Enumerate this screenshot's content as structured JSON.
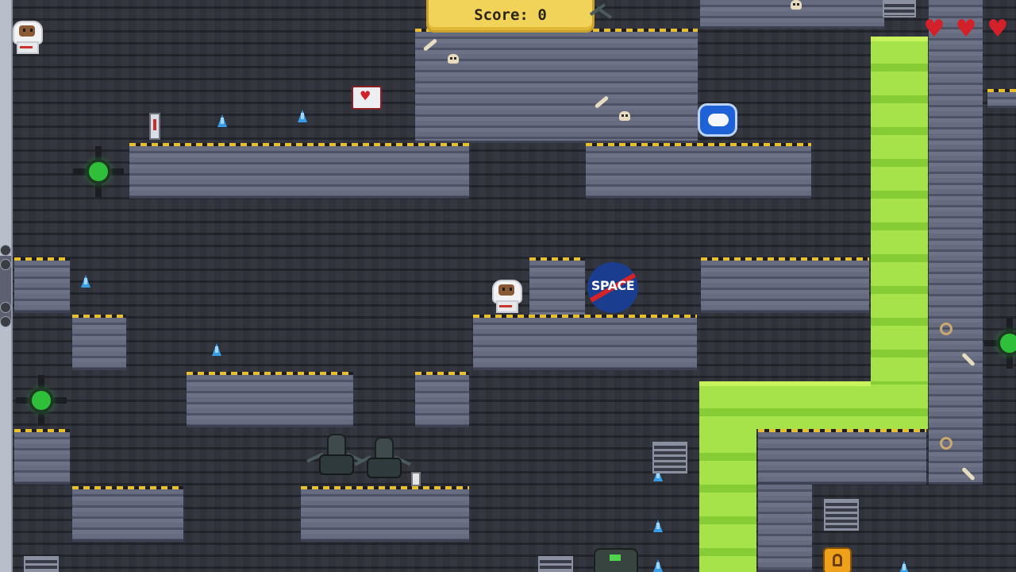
{
  "hud": {
    "score_label": "Score:",
    "score_value": "0",
    "lives": 3,
    "heart_glyph": "♥"
  },
  "space_logo": {
    "text": "SPACE"
  },
  "colors": {
    "acid": "#8fd63a",
    "platform": "#5d6276",
    "hazard_stripe": "#e7c02b",
    "heart": "#d42029",
    "score_panel": "#f2d35a"
  },
  "icons": [
    "astronaut-player-icon",
    "astronaut-life-icon",
    "heart-icon",
    "gem-icon",
    "skull-icon",
    "bone-icon",
    "turret-icon",
    "vent-icon",
    "medkit-icon",
    "beacon-icon",
    "capsule-icon",
    "alien-icon",
    "key-icon",
    "robot-icon"
  ]
}
